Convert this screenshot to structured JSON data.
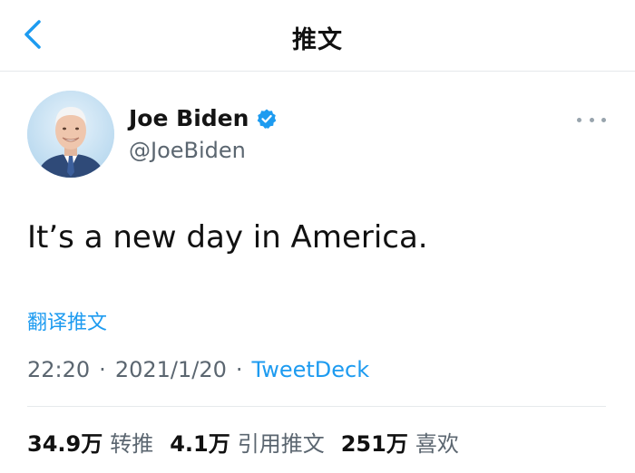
{
  "header": {
    "title": "推文"
  },
  "tweet": {
    "display_name": "Joe Biden",
    "handle": "@JoeBiden",
    "text": "It’s a new day in America.",
    "translate_label": "翻译推文",
    "time": "22:20",
    "date": "2021/1/20",
    "separator": "·",
    "source": "TweetDeck"
  },
  "stats": [
    {
      "value": "34.9万",
      "label": "转推"
    },
    {
      "value": "4.1万",
      "label": "引用推文"
    },
    {
      "value": "251万",
      "label": "喜欢"
    }
  ],
  "colors": {
    "accent": "#1d9bf0",
    "muted": "#5b6670",
    "divider": "#e6e9ec"
  },
  "icons": {
    "back": "chevron-left-icon",
    "verified": "verified-badge-icon",
    "more": "more-horizontal-icon"
  }
}
